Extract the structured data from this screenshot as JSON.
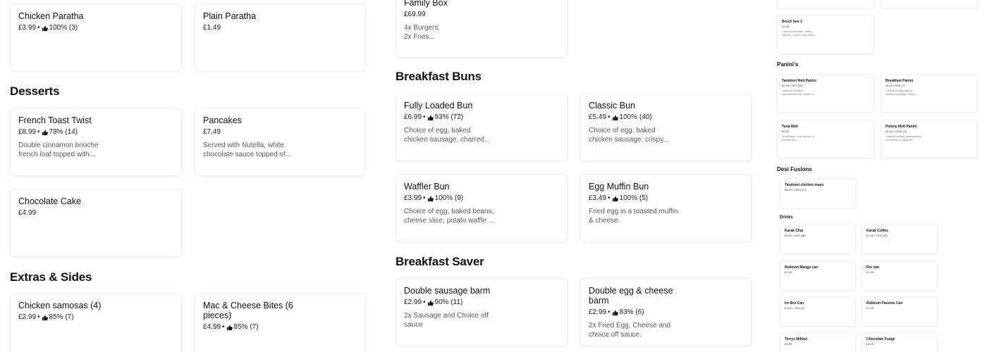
{
  "left": {
    "top_cards": [
      {
        "title": "Chicken Paratha",
        "price": "£3.99",
        "rating": "100% (3)"
      },
      {
        "title": "Plain Paratha",
        "price": "£1.49"
      }
    ],
    "desserts": {
      "heading": "Desserts",
      "cards": [
        {
          "title": "French Toast Twist",
          "price": "£8.99",
          "rating": "78% (14)",
          "desc1": "Double cinnamon brioche",
          "desc2": "french loaf topped with..."
        },
        {
          "title": "Pancakes",
          "price": "£7.49",
          "desc1": "Served with Nutella, white",
          "desc2": "chocolate sauce topped of..."
        },
        {
          "title": "Chocolate Cake",
          "price": "£4.99"
        }
      ]
    },
    "extras": {
      "heading": "Extras & Sides",
      "cards": [
        {
          "title": "Chicken samosas (4)",
          "price": "£2.99",
          "rating": "85% (7)"
        },
        {
          "title1": "Mac & Cheese Bites (6",
          "title2": "pieces)",
          "price": "£4.99",
          "rating": "85% (7)"
        }
      ]
    }
  },
  "middle": {
    "family_box": {
      "title": "Family Box",
      "price": "£69.99",
      "desc1": "4x Burgers",
      "desc2": "2x Fries..."
    },
    "breakfast_buns": {
      "heading": "Breakfast Buns",
      "cards": [
        {
          "title": "Fully Loaded Bun",
          "price": "£6.99",
          "rating": "93% (72)",
          "desc1": "Choice of egg, baked",
          "desc2": "chicken sausage, charred..."
        },
        {
          "title": "Classic Bun",
          "price": "£5.49",
          "rating": "100% (40)",
          "desc1": "Choice of egg, baked",
          "desc2": "chicken sausage, crispy..."
        },
        {
          "title": "Waffler Bun",
          "price": "£3.99",
          "rating": "100% (9)",
          "desc1": "Choice of egg, baked beans,",
          "desc2": "cheese slice, potato waffle ..."
        },
        {
          "title": "Egg Muffin Bun",
          "price": "£3.49",
          "rating": "100% (5)",
          "desc1": "Fried egg in a toasted muffin",
          "desc2": "& cheese."
        }
      ]
    },
    "breakfast_saver": {
      "heading": "Breakfast Saver",
      "cards": [
        {
          "title": "Double sausage barm",
          "price": "£2.99",
          "rating": "90% (11)",
          "desc1": "2x Sausage and Choice off",
          "desc2": "sauce"
        },
        {
          "title1": "Double egg & cheese",
          "title2": "barm",
          "price": "£2.99",
          "rating": "83% (6)",
          "desc1": "2x Fried Egg, Cheese and",
          "desc2": "choice off sauce."
        }
      ]
    }
  },
  "right": {
    "brunch": {
      "title": "Bruch box 2",
      "price": "£6.49",
      "desc1": "Cheese omelette, turkey",
      "desc2": "rashers, beans, over thick..."
    },
    "paninis": {
      "heading": "Panini's",
      "cards": [
        {
          "title": "Tandoori Melt Panini",
          "meta": "£6.99 • 92% (26)",
          "desc1": "Tandoori chicken,",
          "desc2": "caramelised red onions &..."
        },
        {
          "title": "Breakfast Panini",
          "meta": "£6.99 • 80% (7)",
          "desc1": "Choice of egg, baked",
          "desc2": "chicken sausage, crispy..."
        },
        {
          "title": "Tuna Melt",
          "meta": "£6.99",
          "desc1": "Tuna mayo, red onions, &",
          "desc2": "cheese mix."
        },
        {
          "title": "Polony Melt Panini",
          "meta": "£6.99 • 100% (3)",
          "desc1": "Charred polony, caramelised",
          "desc2": "red onions & peppers,..."
        }
      ]
    },
    "desi": {
      "heading": "Desi Fusions",
      "cards": [
        {
          "title": "Tandoori chicken mayo",
          "meta": "£5.99 • 100% (1)"
        }
      ]
    },
    "drinks": {
      "heading": "Drinks",
      "cards": [
        {
          "title": "Karak Chai",
          "meta": "£2.99 • 93% (46)"
        },
        {
          "title": "Karak Coffee",
          "meta": "£2.49 • 75% (22)"
        },
        {
          "title": "Rubicon Mango can",
          "meta": "£1.50"
        },
        {
          "title": "Rio can",
          "meta": "£1.50"
        },
        {
          "title": "Irn Bru Can",
          "meta": "£1.50 • 75% (4)"
        },
        {
          "title": "Rubicon Passion Can",
          "meta": "£1.50"
        },
        {
          "title": "Terrys Million",
          "meta": "£3.99"
        },
        {
          "title": "Chocolate Fudge",
          "meta": "£4.99"
        }
      ]
    }
  }
}
